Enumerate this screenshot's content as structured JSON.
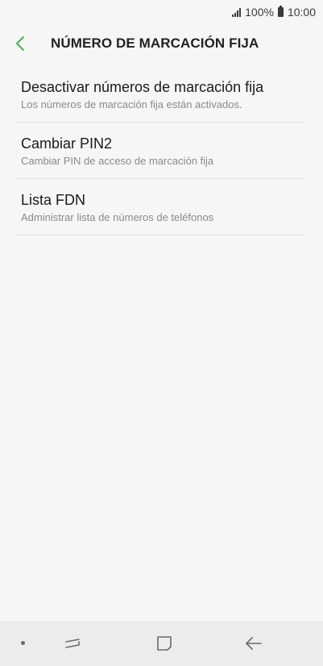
{
  "status_bar": {
    "battery_percent": "100%",
    "time": "10:00",
    "signal_icon": "signal-bars-icon",
    "battery_icon": "battery-icon"
  },
  "header": {
    "title": "NÚMERO DE MARCACIÓN FIJA",
    "back_icon": "chevron-left-icon",
    "accent_color": "#4caf50"
  },
  "menu": {
    "items": [
      {
        "title": "Desactivar números de marcación fija",
        "subtitle": "Los números de marcación fija están activados."
      },
      {
        "title": "Cambiar PIN2",
        "subtitle": "Cambiar PIN de acceso de marcación fija"
      },
      {
        "title": "Lista FDN",
        "subtitle": "Administrar lista de números de teléfonos"
      }
    ]
  },
  "nav_bar": {
    "recents_icon": "recent-apps-icon",
    "home_icon": "home-icon",
    "back_icon": "back-arrow-icon"
  }
}
